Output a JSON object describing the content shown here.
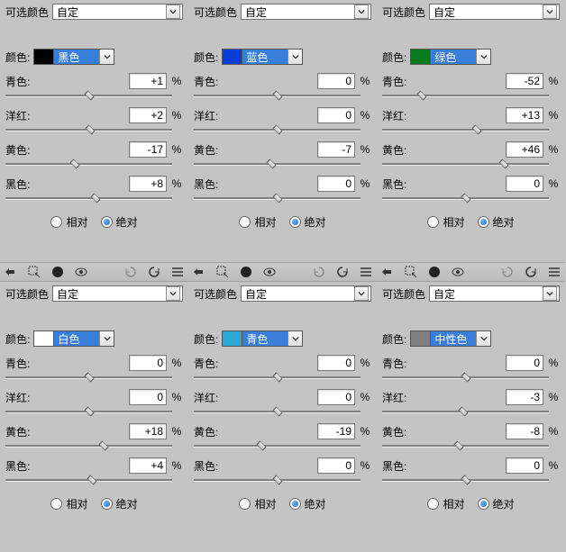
{
  "labels": {
    "preset": "可选颜色",
    "preset_value": "自定",
    "color": "颜色:",
    "cyan": "青色:",
    "magenta": "洋红:",
    "yellow": "黄色:",
    "black": "黑色:",
    "pct": "%",
    "relative": "相对",
    "absolute": "绝对"
  },
  "panels": [
    {
      "color_name": "黑色",
      "swatch": "#000000",
      "label_bg": "#3a7edc",
      "cyan": "+1",
      "magenta": "+2",
      "yellow": "-17",
      "black": "+8",
      "mode": "absolute"
    },
    {
      "color_name": "蓝色",
      "swatch": "#0a3fd6",
      "label_bg": "#3a7edc",
      "cyan": "0",
      "magenta": "0",
      "yellow": "-7",
      "black": "0",
      "mode": "absolute"
    },
    {
      "color_name": "绿色",
      "swatch": "#0a7a1e",
      "label_bg": "#3a7edc",
      "cyan": "-52",
      "magenta": "+13",
      "yellow": "+46",
      "black": "0",
      "mode": "absolute"
    },
    {
      "color_name": "白色",
      "swatch": "#ffffff",
      "label_bg": "#3a7edc",
      "cyan": "0",
      "magenta": "0",
      "yellow": "+18",
      "black": "+4",
      "mode": "absolute"
    },
    {
      "color_name": "青色",
      "swatch": "#2aa7d4",
      "label_bg": "#3a7edc",
      "cyan": "0",
      "magenta": "0",
      "yellow": "-19",
      "black": "0",
      "mode": "absolute"
    },
    {
      "color_name": "中性色",
      "swatch": "#808080",
      "label_bg": "#3a7edc",
      "cyan": "0",
      "magenta": "-3",
      "yellow": "-8",
      "black": "0",
      "mode": "absolute"
    }
  ]
}
